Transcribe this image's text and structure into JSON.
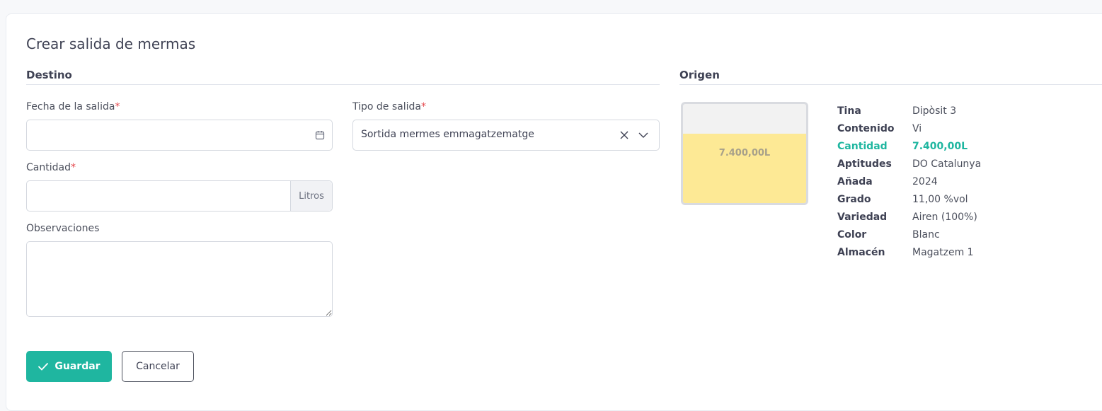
{
  "page": {
    "title": "Crear salida de mermas"
  },
  "destino": {
    "title": "Destino",
    "fecha_label": "Fecha de la salida",
    "tipo_label": "Tipo de salida",
    "tipo_value": "Sortida mermes emmagatzematge",
    "cantidad_label": "Cantidad",
    "cantidad_unit": "Litros",
    "observaciones_label": "Observaciones",
    "required_mark": "*"
  },
  "origen": {
    "title": "Origen",
    "tank_label": "7.400,00L",
    "tank_fill_fraction": 0.7,
    "rows": [
      {
        "key": "Tina",
        "value": "Dipòsit 3"
      },
      {
        "key": "Contenido",
        "value": "Vi"
      },
      {
        "key": "Cantidad",
        "value": "7.400,00L"
      },
      {
        "key": "Aptitudes",
        "value": "DO Catalunya"
      },
      {
        "key": "Añada",
        "value": "2024"
      },
      {
        "key": "Grado",
        "value": "11,00 %vol"
      },
      {
        "key": "Variedad",
        "value": "Airen (100%)"
      },
      {
        "key": "Color",
        "value": "Blanc"
      },
      {
        "key": "Almacén",
        "value": "Magatzem 1"
      }
    ]
  },
  "actions": {
    "save_label": "Guardar",
    "cancel_label": "Cancelar"
  },
  "colors": {
    "accent": "#1fb6a0",
    "tank_fill": "#fde995",
    "required": "#e5484d"
  }
}
